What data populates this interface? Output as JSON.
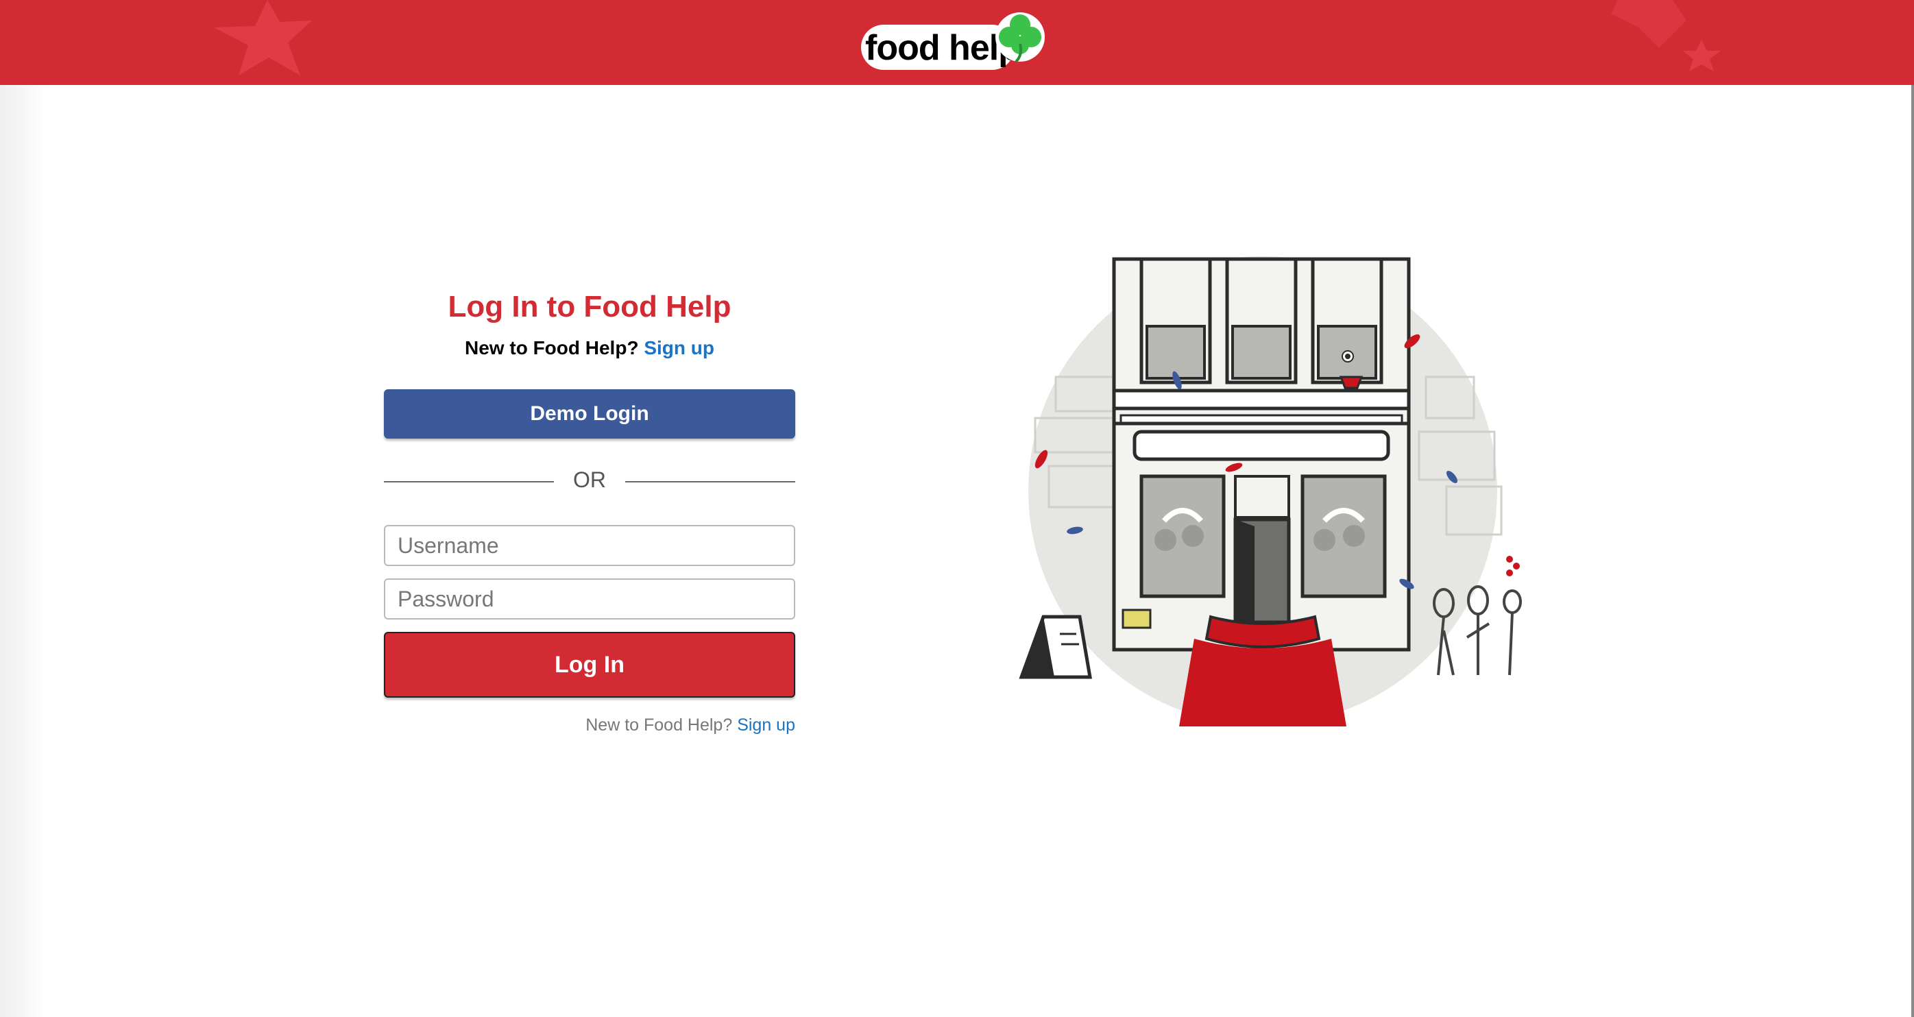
{
  "header": {
    "logo_text": "food help",
    "logo_icon": "clover-icon",
    "background_color": "#d32b34"
  },
  "login": {
    "title": "Log In to Food Help",
    "new_prompt": "New to Food Help?",
    "signup_link": "Sign up",
    "demo_button": "Demo Login",
    "divider_text": "OR",
    "username_placeholder": "Username",
    "password_placeholder": "Password",
    "login_button": "Log In",
    "bottom_prompt": "New to Food Help?",
    "bottom_signup_link": "Sign up"
  },
  "colors": {
    "brand_red": "#d32b34",
    "demo_blue": "#3c5a9a",
    "link_blue": "#1a73c4"
  },
  "illustration": {
    "icon": "restaurant-storefront-illustration"
  }
}
